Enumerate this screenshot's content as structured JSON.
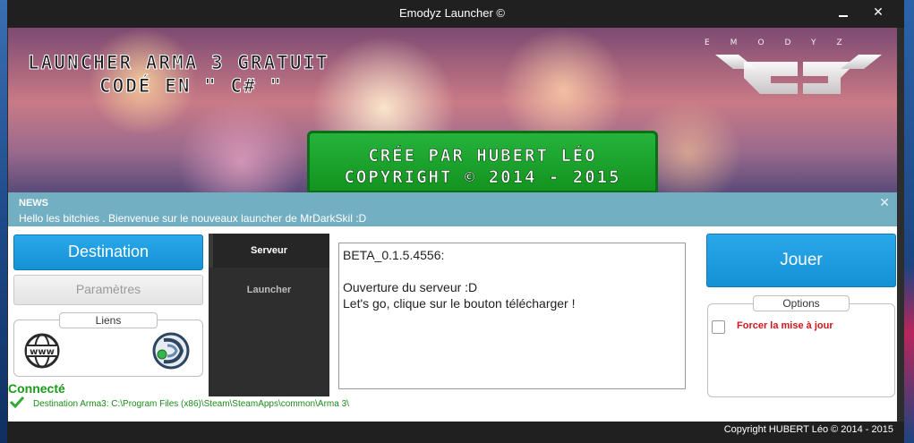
{
  "window": {
    "title": "Emodyz Launcher ©",
    "minimize_symbol": "",
    "close_symbol": "✕"
  },
  "banner": {
    "title_line1": "LAUNCHER ARMA 3 GRATUIT",
    "title_line2": "CODÉ EN \" C# \"",
    "logo_letters": "EMODYZ",
    "credit_line1": "CRÉE PAR HUBERT LÉO",
    "credit_line2": "COPYRIGHT © 2014 - 2015"
  },
  "news": {
    "title": "NEWS",
    "message": "Hello les bitchies . Bienvenue sur le nouveaux launcher de MrDarkSkil :D",
    "close_symbol": "✕"
  },
  "left_panel": {
    "destination_label": "Destination",
    "parametres_label": "Paramètres",
    "liens_label": "Liens",
    "www_text": "www",
    "status": "Connecté",
    "destination_path": "Destination Arma3: C:\\Program Files (x86)\\Steam\\SteamApps\\common\\Arma 3\\"
  },
  "nav": {
    "items": [
      {
        "label": "Serveur"
      },
      {
        "label": "Launcher"
      }
    ]
  },
  "content": {
    "lines": [
      "BETA_0.1.5.4556:",
      "",
      "Ouverture du serveur :D",
      "Let's go, clique sur le bouton télécharger !"
    ]
  },
  "right_panel": {
    "jouer_label": "Jouer",
    "options_label": "Options",
    "checkbox_label": "Forcer la mise à jour",
    "checkbox_checked": false
  },
  "footer": {
    "copyright": "Copyright HUBERT Léo © 2014 - 2015"
  },
  "colors": {
    "accent_blue": "#1fa0e3",
    "news_bg": "#72afc3",
    "green": "#1a9b1a",
    "warning_red": "#d6131f"
  }
}
